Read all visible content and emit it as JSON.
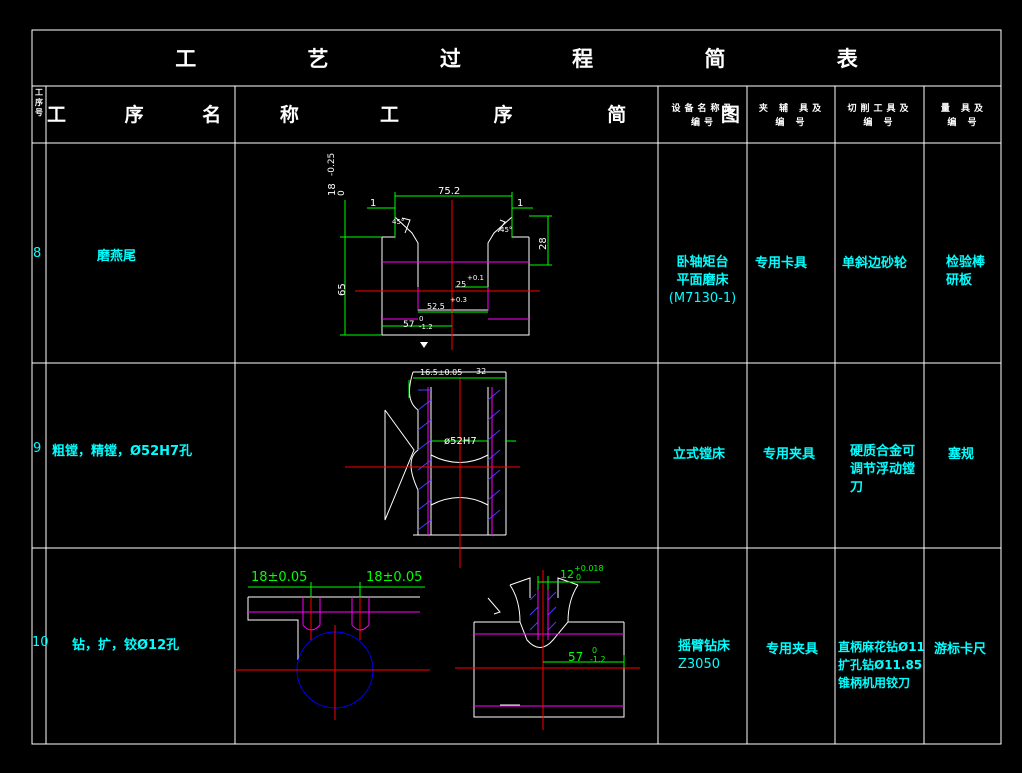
{
  "title": "工 艺 过 程 简 表",
  "header": {
    "seq": "工序号",
    "name": "工 序 名 称",
    "sketch": "工 序 简 图",
    "equipment": "设备名称及编号",
    "fixture": "夹 辅 具及 编 号",
    "cutter": "切削工具及 编 号",
    "gauge": "量 具及 编 号"
  },
  "rows": [
    {
      "seq": "8",
      "name": "磨燕尾",
      "equipment": [
        "卧轴矩台",
        "平面磨床",
        "(M7130-1)"
      ],
      "fixture": "专用卡具",
      "cutter": "单斜边砂轮",
      "gauge": [
        "检验棒",
        "研板"
      ],
      "dims": {
        "d1": "75.2",
        "d2": "1",
        "d3": "1",
        "d4": "18",
        "d5": "-0.25",
        "d6": "0",
        "d7": "28",
        "d8": "65",
        "d9": "25",
        "d10": "+0.1",
        "d11": "52.5",
        "d12": "57",
        "d13": "-1.2",
        "d14": "0",
        "d15": "+0.3",
        "d16": "45°",
        "d17": "45°"
      }
    },
    {
      "seq": "9",
      "name": "粗镗，精镗，Ø52H7孔",
      "equipment": [
        "立式镗床"
      ],
      "fixture": "专用夹具",
      "cutter": [
        "硬质合金可",
        "调节浮动镗",
        "刀"
      ],
      "gauge": [
        "塞规"
      ],
      "dims": {
        "d1": "16.5±0.05",
        "d2": "32",
        "d3": "ø52H7"
      }
    },
    {
      "seq": "10",
      "name": "钻，扩，铰Ø12孔",
      "equipment": [
        "摇臂钻床",
        "Z3050"
      ],
      "fixture": "专用夹具",
      "cutter": [
        "直柄麻花钻Ø11",
        "扩孔钻Ø11.85",
        "锥柄机用铰刀"
      ],
      "gauge": [
        "游标卡尺"
      ],
      "dims": {
        "d1": "18±0.05",
        "d2": "18±0.05",
        "d3": "12",
        "d4": "+0.018",
        "d5": "0",
        "d6": "57",
        "d7": "-1.2",
        "d8": "0"
      }
    }
  ],
  "colors": {
    "background": "#000000",
    "grid": "#ffffff",
    "text": "#00ffff",
    "dimension": "#00ff00",
    "centerline": "#ff0000",
    "hidden": "#ff00ff",
    "hatch": "#4040ff",
    "circle": "#0000ff"
  }
}
